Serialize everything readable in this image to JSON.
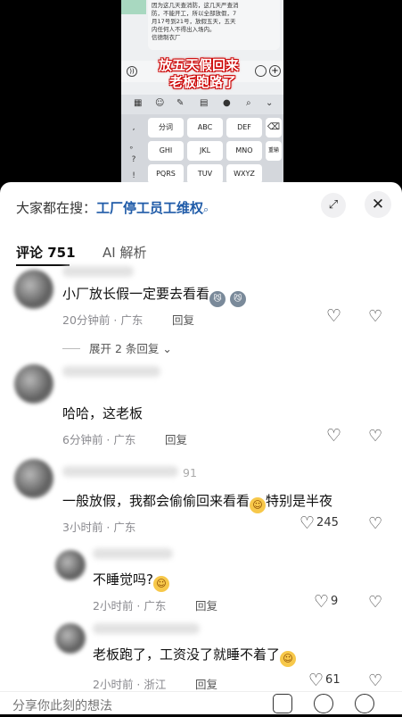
{
  "video": {
    "chat_lines": [
      "因为这几天查消防，这几天严查消",
      "防，不能开工，所以全部放假，7",
      "月17号到21号，放假五天，五天",
      "内任何人不得出入场内。",
      "信德制衣厂"
    ],
    "caption_line1": "放五天假回来",
    "caption_line2": "老板跑路了",
    "keyboard_keys": [
      "分词",
      "ABC",
      "DEF",
      "GHI",
      "JKL",
      "MNO",
      "PQRS",
      "TUV",
      "WXYZ"
    ],
    "side_keys": [
      ",",
      "。",
      "?",
      "!"
    ],
    "delete_label": "⌫",
    "reenter_label": "重输"
  },
  "header": {
    "search_prefix": "大家都在搜：",
    "search_keyword": "工厂停工员工维权",
    "search_icon": "search-icon",
    "expand_icon": "expand-icon",
    "close_icon": "close-icon"
  },
  "tabs": {
    "comments": "评论 751",
    "ai": "AI 解析"
  },
  "comments": [
    {
      "text": "小厂放长假一定要去看看",
      "emojis": [
        "😼",
        "😼"
      ],
      "time": "20分钟前 · 广东",
      "reply": "回复",
      "likes": ""
    },
    {
      "text": "哈哈，这老板",
      "time": "6分钟前 · 广东",
      "reply": "回复",
      "likes": ""
    },
    {
      "name_fragment": "91",
      "text_a": "一般放假，我都会偷偷回来看看",
      "text_b": "特别是半夜",
      "time": "3小时前 · 广东",
      "reply": "",
      "likes": "245"
    }
  ],
  "replies": [
    {
      "text": "不睡觉吗?",
      "time": "2小时前 · 广东",
      "reply": "回复",
      "likes": "9"
    },
    {
      "text": "老板跑了，工资没了就睡不着了",
      "time": "2小时前 · 浙江",
      "reply": "回复",
      "likes": "61"
    }
  ],
  "expand_replies": "展开 2 条回复",
  "composer": {
    "placeholder": "分享你此刻的想法"
  }
}
